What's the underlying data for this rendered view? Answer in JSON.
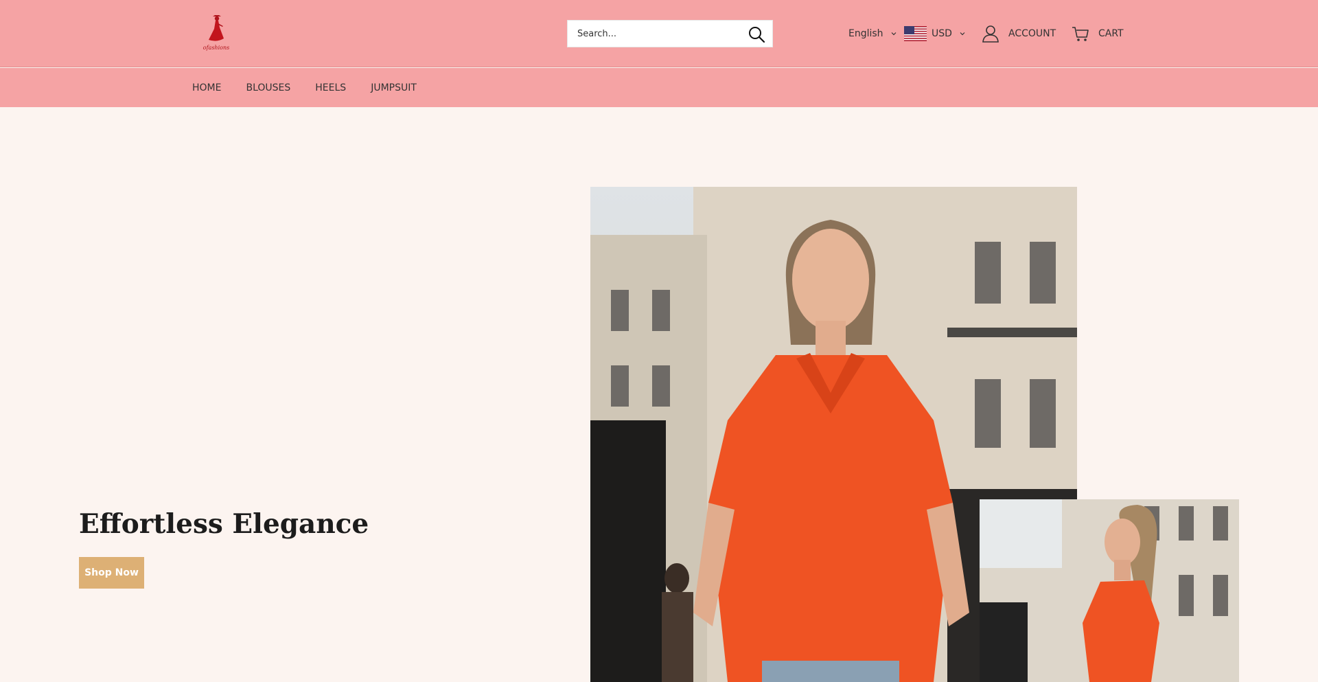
{
  "header": {
    "logo_text": "ofashions",
    "search": {
      "placeholder": "Search..."
    },
    "language": "English",
    "currency": "USD",
    "account_label": "ACCOUNT",
    "cart_label": "CART"
  },
  "menu": {
    "items": [
      {
        "label": "HOME"
      },
      {
        "label": "BLOUSES"
      },
      {
        "label": "HEELS"
      },
      {
        "label": "JUMPSUIT"
      }
    ]
  },
  "hero": {
    "title": "Effortless Elegance",
    "button_label": "Shop Now"
  },
  "colors": {
    "header_bg": "#f5a3a4",
    "page_bg": "#fcf4f0",
    "button_bg": "#ddb075",
    "logo_red": "#b0131b",
    "blouse_orange": "#ef5323"
  }
}
